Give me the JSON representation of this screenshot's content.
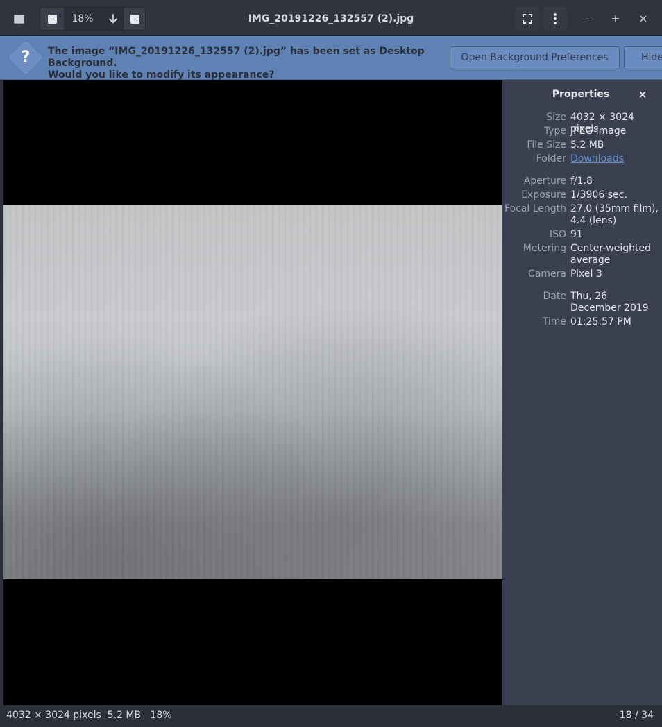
{
  "window": {
    "title": "IMG_20191226_132557 (2).jpg"
  },
  "toolbar": {
    "zoom_level": "18%",
    "zoom_menu_icon": "arrow-down-icon",
    "min_icon": "–",
    "max_icon": "+",
    "close_icon": "×"
  },
  "infobar": {
    "message_line1": "The image “IMG_20191226_132557 (2).jpg” has been set as Desktop Background.",
    "message_line2": "Would you like to modify its appearance?",
    "open_prefs_label": "Open Background Preferences",
    "hide_label": "Hide",
    "icon": "question-icon"
  },
  "properties": {
    "title": "Properties",
    "close_icon": "×",
    "items": [
      {
        "key": "Size",
        "value": "4032 × 3024 pixels"
      },
      {
        "key": "Type",
        "value": "JPEG image"
      },
      {
        "key": "File Size",
        "value": "5.2 MB"
      },
      {
        "key": "Folder",
        "value": "Downloads"
      },
      {
        "key": "Aperture",
        "value": "f/1.8"
      },
      {
        "key": "Exposure",
        "value": "1/3906 sec."
      },
      {
        "key": "Focal Length",
        "value": "27.0 (35mm film), 4.4 (lens)"
      },
      {
        "key": "ISO",
        "value": "91"
      },
      {
        "key": "Metering",
        "value": "Center-weighted average"
      },
      {
        "key": "Camera",
        "value": "Pixel 3"
      },
      {
        "key": "Date",
        "value": "Thu, 26 December 2019"
      },
      {
        "key": "Time",
        "value": "01:25:57 PM"
      }
    ]
  },
  "statusbar": {
    "left": "4032 × 3024 pixels  5.2 MB   18%",
    "right": "18 / 34"
  },
  "colors": {
    "infobar": "#5f82b5",
    "sidebar": "#3a404f",
    "link": "#5f8ed0"
  }
}
